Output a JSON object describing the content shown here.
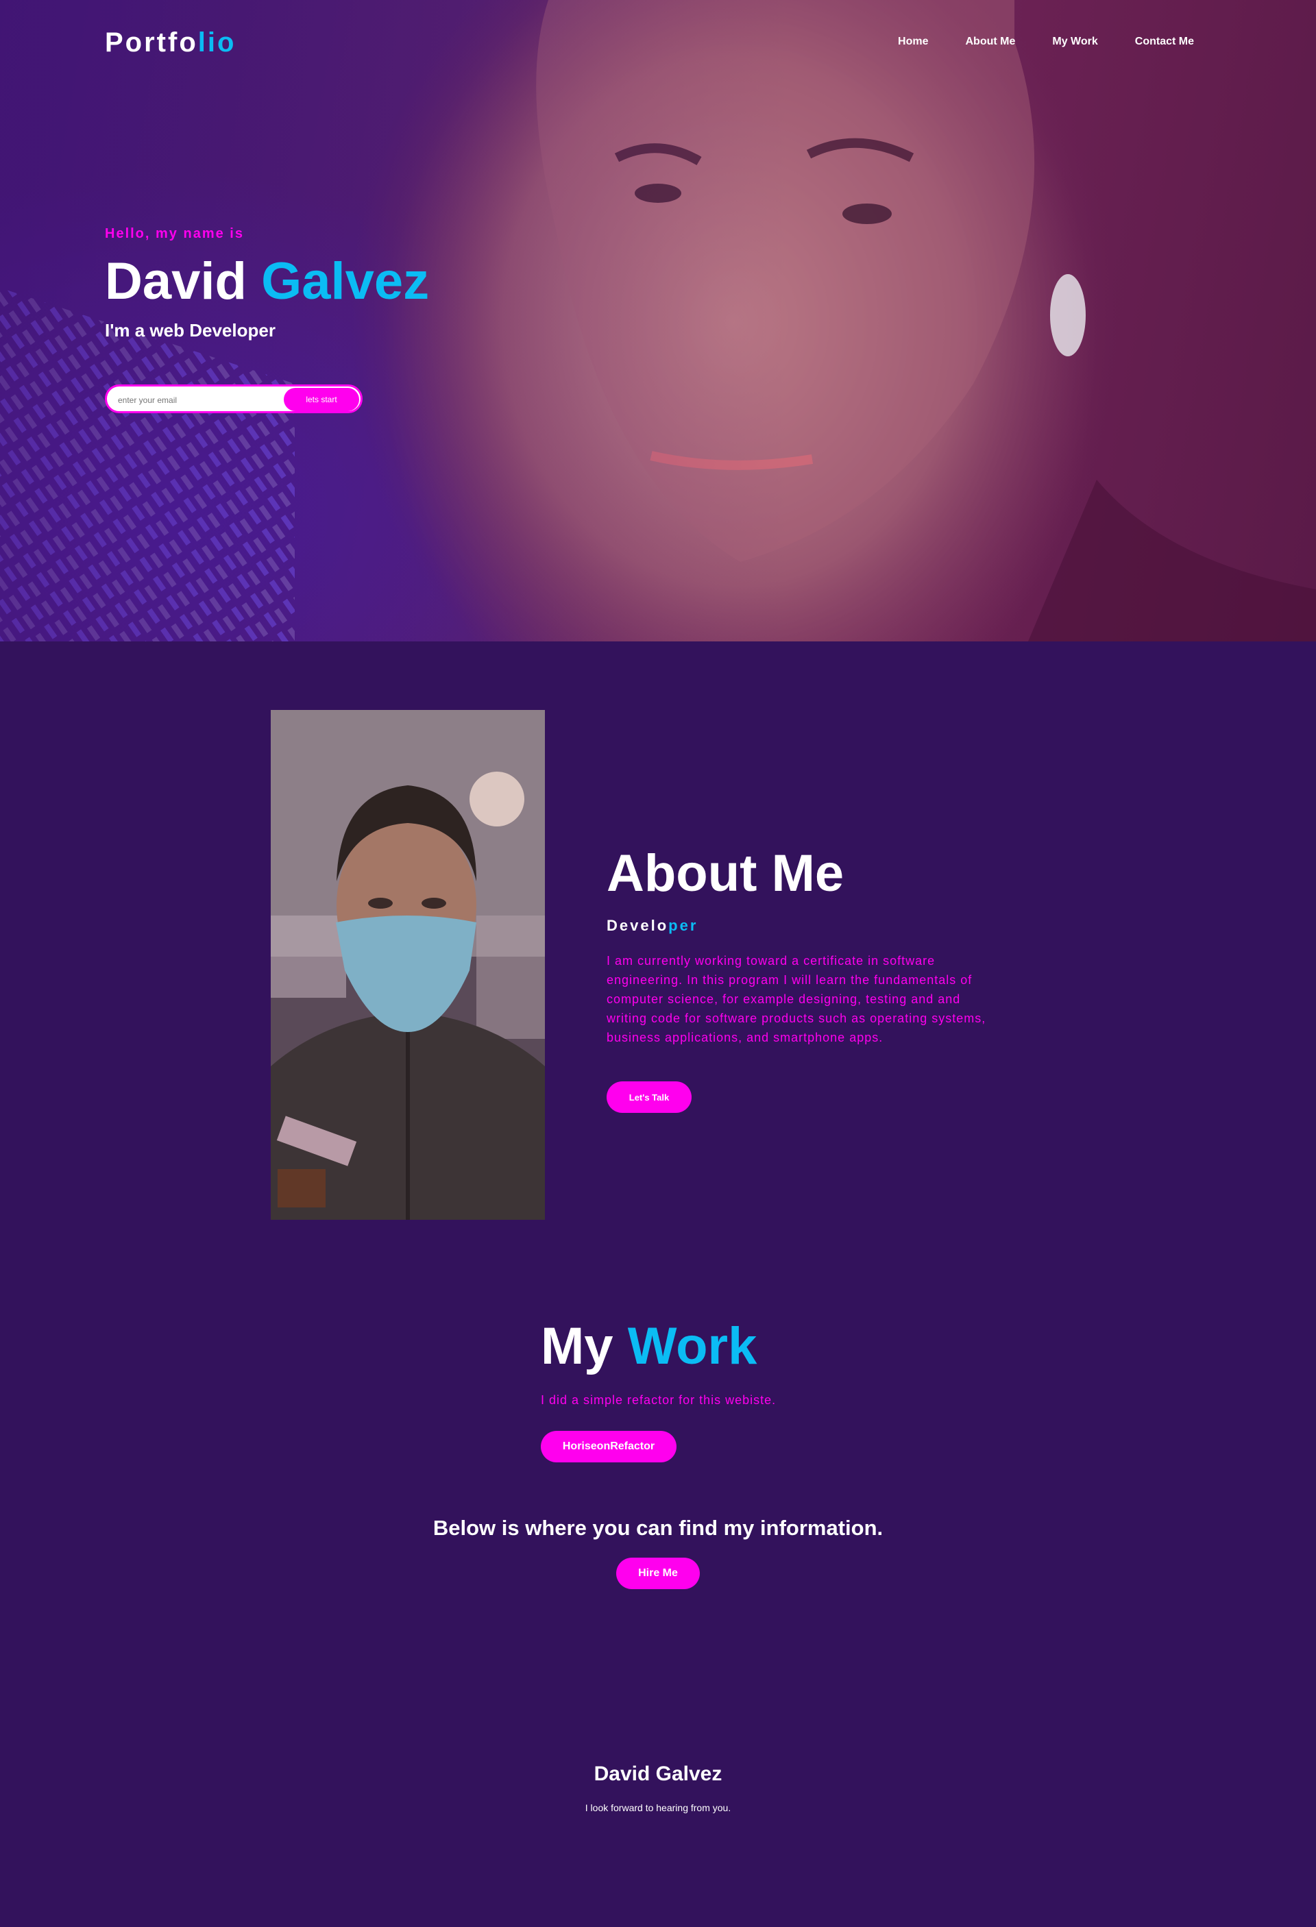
{
  "nav": {
    "logo_main": "Portfo",
    "logo_accent": "lio",
    "links": [
      "Home",
      "About Me",
      "My Work",
      "Contact Me"
    ]
  },
  "hero": {
    "greeting": "Hello, my name is",
    "first_name": "David",
    "last_name": "Galvez",
    "subtitle": "I'm a web Developer",
    "email_placeholder": "enter your email",
    "cta_label": "lets start"
  },
  "about": {
    "title": "About Me",
    "role_main": "Develo",
    "role_accent": "per",
    "description": "I am currently working toward a certificate in software engineering. In this program I will learn the fundamentals of computer science, for example designing, testing and and writing code for software products such as operating systems, business applications, and smartphone apps.",
    "button_label": "Let's Talk"
  },
  "work": {
    "title_main": "My",
    "title_accent": "Work",
    "description": "I did a simple refactor for this webiste.",
    "project_button": "HoriseonRefactor",
    "info_heading": "Below is where you can find my information.",
    "hire_button": "Hire Me"
  },
  "footer": {
    "name": "David Galvez",
    "message": "I look forward to hearing from you."
  },
  "colors": {
    "background": "#33125c",
    "accent_blue": "#0bbcf4",
    "accent_pink": "#ff00ee",
    "text": "#ffffff"
  }
}
